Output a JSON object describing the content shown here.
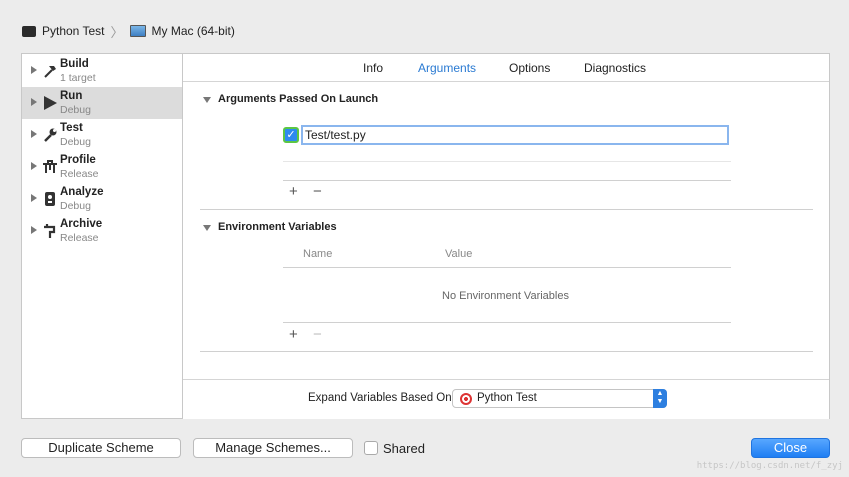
{
  "breadcrumb": {
    "scheme": "Python Test",
    "destination": "My Mac (64-bit)"
  },
  "sidebar": {
    "items": [
      {
        "title": "Build",
        "subtitle": "1 target",
        "icon": "hammer-icon"
      },
      {
        "title": "Run",
        "subtitle": "Debug",
        "icon": "play-icon"
      },
      {
        "title": "Test",
        "subtitle": "Debug",
        "icon": "wrench-icon"
      },
      {
        "title": "Profile",
        "subtitle": "Release",
        "icon": "instruments-icon"
      },
      {
        "title": "Analyze",
        "subtitle": "Debug",
        "icon": "analyze-icon"
      },
      {
        "title": "Archive",
        "subtitle": "Release",
        "icon": "archive-icon"
      }
    ],
    "selected_index": 1
  },
  "tabs": [
    {
      "label": "Info"
    },
    {
      "label": "Arguments"
    },
    {
      "label": "Options"
    },
    {
      "label": "Diagnostics"
    }
  ],
  "active_tab": "Arguments",
  "arguments": {
    "title": "Arguments Passed On Launch",
    "items": [
      {
        "value": "Test/test.py",
        "checked": true
      }
    ]
  },
  "environment": {
    "title": "Environment Variables",
    "col_name": "Name",
    "col_value": "Value",
    "empty_text": "No Environment Variables"
  },
  "expand": {
    "label": "Expand Variables Based On",
    "value": "Python Test"
  },
  "footer": {
    "duplicate": "Duplicate Scheme",
    "manage": "Manage Schemes...",
    "shared": "Shared",
    "close": "Close"
  },
  "watermark": "https://blog.csdn.net/f_zyj",
  "colors": {
    "accent": "#2a7ad2",
    "primary_button": "#1f7ef3",
    "checkbox": "#2d8af0"
  }
}
